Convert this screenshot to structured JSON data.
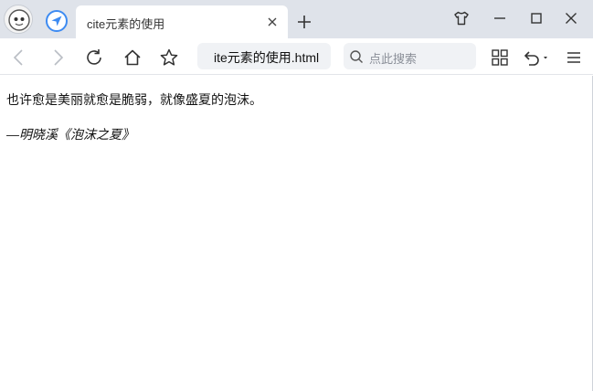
{
  "browser": {
    "tab": {
      "title": "cite元素的使用"
    },
    "address": {
      "value": "ite元素的使用.html"
    },
    "search": {
      "placeholder": "点此搜索"
    },
    "icons": {
      "profile": "avatar-icon",
      "nav": "navigation-arrow-icon",
      "close_tab": "close-icon",
      "new_tab": "plus-icon",
      "skin": "tshirt-icon",
      "minimize": "minimize-icon",
      "maximize": "maximize-icon",
      "close_window": "close-icon",
      "back": "chevron-left-icon",
      "forward": "chevron-right-icon",
      "reload": "reload-icon",
      "home": "home-icon",
      "bookmark": "star-icon",
      "apps": "grid-icon",
      "undo": "undo-icon",
      "menu": "hamburger-menu-icon"
    },
    "colors": {
      "tabbar": "#dfe3ea",
      "accent": "#3d8bf2"
    }
  },
  "page": {
    "quote": "也许愈是美丽就愈是脆弱，就像盛夏的泡沫。",
    "cite": "—明晓溪《泡沫之夏》"
  }
}
